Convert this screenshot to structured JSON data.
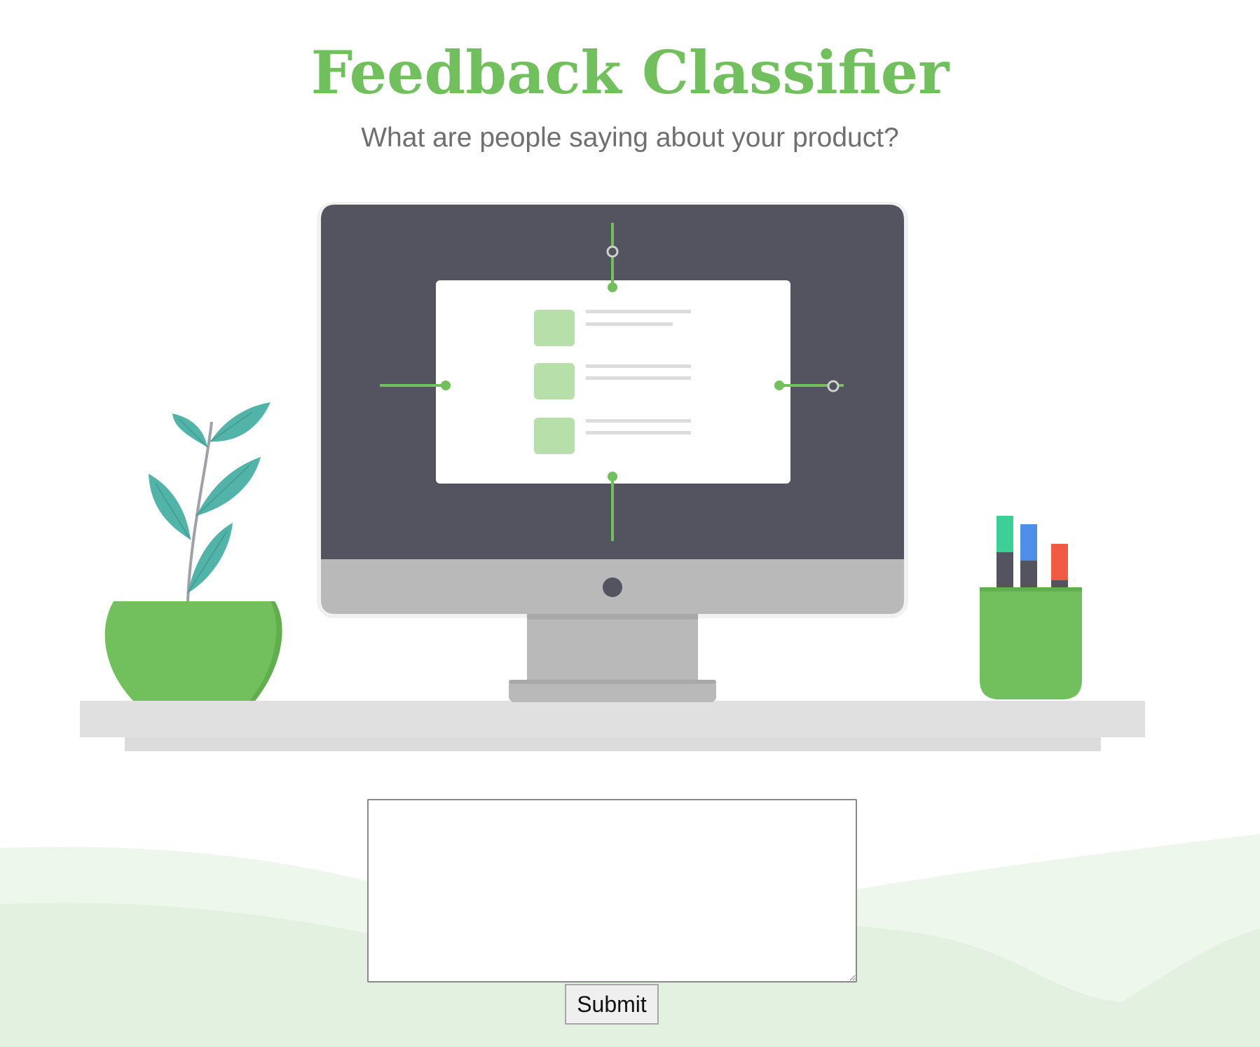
{
  "header": {
    "title": "Feedback Classifier",
    "subtitle": "What are people saying about your product?"
  },
  "form": {
    "feedback_value": "",
    "feedback_placeholder": "",
    "submit_label": "Submit"
  },
  "illustration": {
    "screen_rows": 3
  },
  "colors": {
    "accent": "#72c05d",
    "monitor_frame": "#545460",
    "monitor_bezel": "#b9b9b9",
    "leaves": "#52b3a8",
    "marker_green": "#3ecf96",
    "marker_blue": "#4d8ee8",
    "marker_red": "#f05a42",
    "hills": "#e3f2e0"
  }
}
